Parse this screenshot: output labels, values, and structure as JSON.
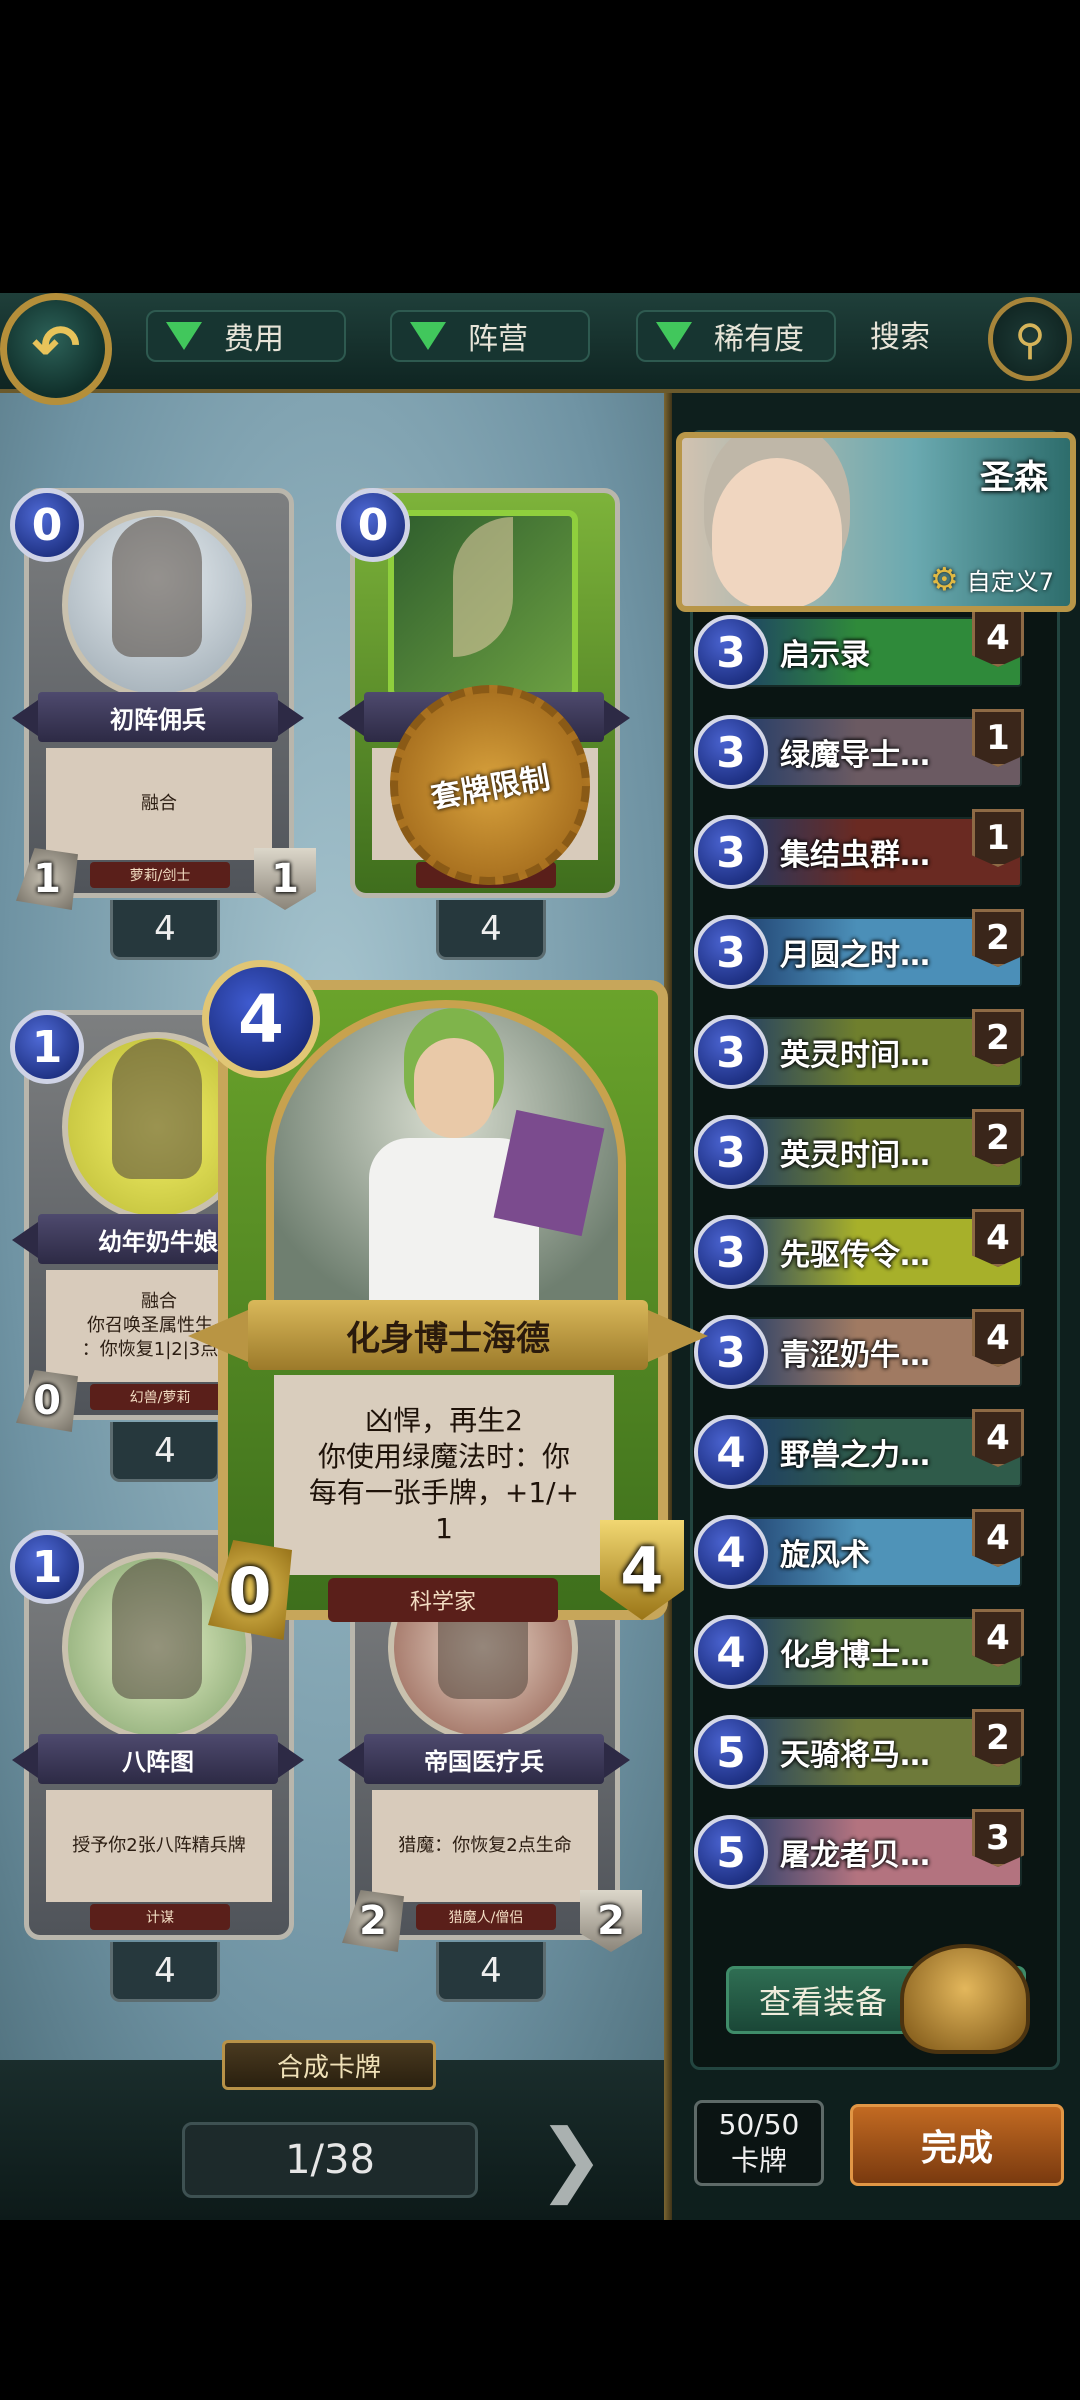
{
  "topbar": {
    "filters": [
      {
        "label": "费用"
      },
      {
        "label": "阵营"
      },
      {
        "label": "稀有度"
      }
    ],
    "search_label": "搜索"
  },
  "collection": {
    "cards": [
      {
        "name": "初阵佣兵",
        "cost": "0",
        "text": [
          "融合"
        ],
        "type": "萝莉/剑士",
        "attack": "1",
        "health": "1",
        "owned": "4",
        "art": "portrait"
      },
      {
        "name": "",
        "cost": "0",
        "text": [
          "⋯"
        ],
        "type": "绿魔法",
        "attack": "",
        "health": "",
        "owned": "4",
        "art": "green"
      },
      {
        "name": "幼年奶牛娘",
        "cost": "1",
        "text": [
          "融合",
          "你召唤圣属性生⋯",
          "：你恢复1|2|3点⋯"
        ],
        "type": "幻兽/萝莉",
        "attack": "0",
        "health": "",
        "owned": "4",
        "art": "yellow"
      },
      {
        "name": "八阵图",
        "cost": "1",
        "text": [
          "授予你2张八阵精兵牌"
        ],
        "type": "计谋",
        "attack": "",
        "health": "",
        "owned": "4",
        "art": "pale"
      },
      {
        "name": "帝国医疗兵",
        "cost": "",
        "text": [
          "猎魔：你恢复2点生命"
        ],
        "type": "猎魔人/僧侣",
        "attack": "2",
        "health": "2",
        "owned": "4",
        "art": "red"
      }
    ],
    "limit_seal": "套牌限制",
    "craft_label": "合成卡牌",
    "page": "1/38"
  },
  "selected_card": {
    "name": "化身博士海德",
    "cost": "4",
    "text": [
      "凶悍，再生2",
      "你使用绿魔法时：你",
      "每有一张手牌，+1/+",
      "1"
    ],
    "type": "科学家",
    "attack": "0",
    "health": "4"
  },
  "deck": {
    "hero_name": "圣森",
    "custom_label": "自定义7",
    "cards": [
      {
        "cost": "3",
        "name": "启示录",
        "count": "4",
        "color": "#2f8a3a"
      },
      {
        "cost": "3",
        "name": "绿魔导士…",
        "count": "1",
        "color": "#6b5a62"
      },
      {
        "cost": "3",
        "name": "集结虫群…",
        "count": "1",
        "color": "#6a2a22"
      },
      {
        "cost": "3",
        "name": "月圆之时…",
        "count": "2",
        "color": "#4b8fb8"
      },
      {
        "cost": "3",
        "name": "英灵时间…",
        "count": "2",
        "color": "#6f7f2d"
      },
      {
        "cost": "3",
        "name": "英灵时间…",
        "count": "2",
        "color": "#6f7f2d"
      },
      {
        "cost": "3",
        "name": "先驱传令…",
        "count": "4",
        "color": "#a7b02a"
      },
      {
        "cost": "3",
        "name": "青涩奶牛…",
        "count": "4",
        "color": "#a07a62"
      },
      {
        "cost": "4",
        "name": "野兽之力…",
        "count": "4",
        "color": "#2f5b4a"
      },
      {
        "cost": "4",
        "name": "旋风术",
        "count": "4",
        "color": "#4f93b8"
      },
      {
        "cost": "4",
        "name": "化身博士…",
        "count": "4",
        "color": "#5e7a3c"
      },
      {
        "cost": "5",
        "name": "天骑将马…",
        "count": "2",
        "color": "#6e7a3a"
      },
      {
        "cost": "5",
        "name": "屠龙者贝…",
        "count": "3",
        "color": "#b3737f"
      }
    ],
    "equip_label": "查看装备",
    "size_count": "50/50",
    "size_unit": "卡牌",
    "done_label": "完成"
  }
}
